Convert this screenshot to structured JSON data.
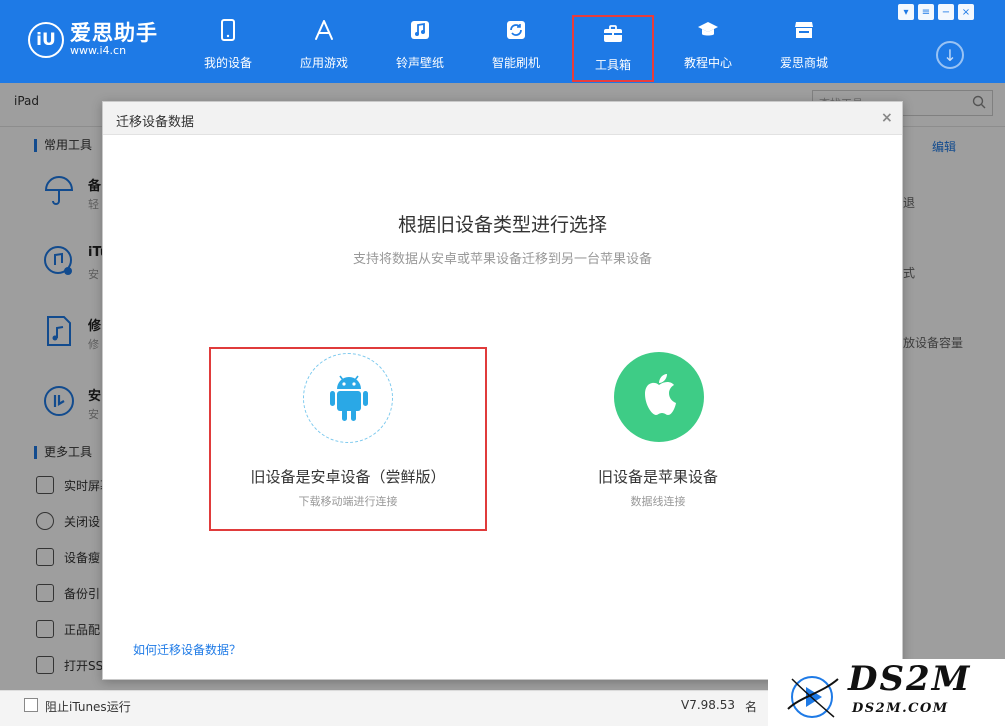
{
  "app": {
    "logo_badge": "iU",
    "logo_name": "爱思助手",
    "logo_url": "www.i4.cn"
  },
  "nav": {
    "items": [
      {
        "label": "我的设备",
        "icon": "phone-icon"
      },
      {
        "label": "应用游戏",
        "icon": "app-store-icon"
      },
      {
        "label": "铃声壁纸",
        "icon": "music-note-icon"
      },
      {
        "label": "智能刷机",
        "icon": "flash-refresh-icon"
      },
      {
        "label": "工具箱",
        "icon": "toolbox-icon",
        "active": true
      },
      {
        "label": "教程中心",
        "icon": "graduation-cap-icon"
      },
      {
        "label": "爱思商城",
        "icon": "store-icon"
      }
    ]
  },
  "subbar": {
    "device_tab": "iPad",
    "search_placeholder": "查找工具"
  },
  "background": {
    "common_tools_title": "常用工具",
    "more_tools_title": "更多工具",
    "edit_label": "编辑",
    "tools": [
      {
        "name": "备",
        "desc": "轻",
        "icon": "umbrella-icon"
      },
      {
        "name": "iTu",
        "desc": "安",
        "icon": "itunes-icon"
      },
      {
        "name": "修",
        "desc": "修",
        "icon": "music-file-icon"
      },
      {
        "name": "安",
        "desc": "安",
        "icon": "i4-logo-icon"
      }
    ],
    "more_tools": [
      {
        "label": "实时屏幕",
        "icon": "screen-mirror-icon"
      },
      {
        "label": "关闭设",
        "icon": "power-icon"
      },
      {
        "label": "设备瘦",
        "icon": "trash-icon"
      },
      {
        "label": "备份引",
        "icon": "backup-icon"
      },
      {
        "label": "正品配",
        "icon": "cable-icon"
      },
      {
        "label": "打开SS",
        "icon": "terminal-icon"
      }
    ],
    "right_fragments": [
      "退",
      "式",
      "放设备容量"
    ]
  },
  "statusbar": {
    "itunes_label": "阻止iTunes运行",
    "version": "V7.98.53",
    "fragment": "名"
  },
  "watermark": {
    "big": "DS2M",
    "small": "DS2M.COM"
  },
  "dialog": {
    "title": "迁移设备数据",
    "close": "×",
    "heading": "根据旧设备类型进行选择",
    "subheading": "支持将数据从安卓或苹果设备迁移到另一台苹果设备",
    "options": [
      {
        "title": "旧设备是安卓设备（尝鲜版）",
        "desc": "下载移动端进行连接",
        "icon": "android-icon",
        "selected": true,
        "accent": "#2aa8e6"
      },
      {
        "title": "旧设备是苹果设备",
        "desc": "数据线连接",
        "icon": "apple-icon",
        "selected": false,
        "accent": "#3ecc86"
      }
    ],
    "help_link": "如何迁移设备数据？"
  },
  "colors": {
    "header_blue": "#1e7ae6",
    "highlight_red": "#e03b3b",
    "android_blue": "#2aa8e6",
    "apple_green": "#3ecc86"
  }
}
